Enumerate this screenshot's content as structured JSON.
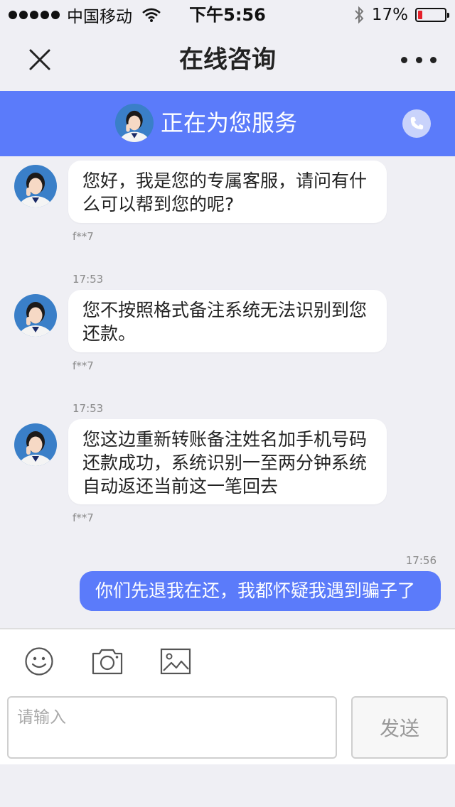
{
  "status_bar": {
    "carrier": "中国移动",
    "time": "下午5:56",
    "battery_percent": "17%",
    "battery_level": 0.17,
    "icons": [
      "signal-dots-icon",
      "wifi-icon",
      "bluetooth-icon",
      "battery-icon"
    ]
  },
  "nav": {
    "title": "在线咨询",
    "close_icon": "close-icon",
    "more_icon": "more-icon"
  },
  "banner": {
    "text": "正在为您服务",
    "phone_icon": "phone-icon"
  },
  "messages": [
    {
      "from": "agent",
      "text": "您好，我是您的专属客服，请问有什么可以帮到您的呢?",
      "sender": "f**7"
    },
    {
      "timestamp": "17:53"
    },
    {
      "from": "agent",
      "text": " 您不按照格式备注系统无法识别到您还款。",
      "sender": "f**7"
    },
    {
      "timestamp": "17:53"
    },
    {
      "from": "agent",
      "text": "您这边重新转账备注姓名加手机号码还款成功，系统识别一至两分钟系统自动返还当前这一笔回去",
      "sender": "f**7"
    },
    {
      "timestamp": "17:56"
    },
    {
      "from": "user",
      "text": "你们先退我在还，我都怀疑我遇到骗子了"
    }
  ],
  "toolbar": {
    "icons": [
      "emoji-icon",
      "camera-icon",
      "image-icon"
    ],
    "input_placeholder": "请输入",
    "send_label": "发送"
  },
  "colors": {
    "accent": "#5b7bfa",
    "background": "#efeff4",
    "bubble": "#ffffff",
    "battery_low": "#e5202a"
  }
}
